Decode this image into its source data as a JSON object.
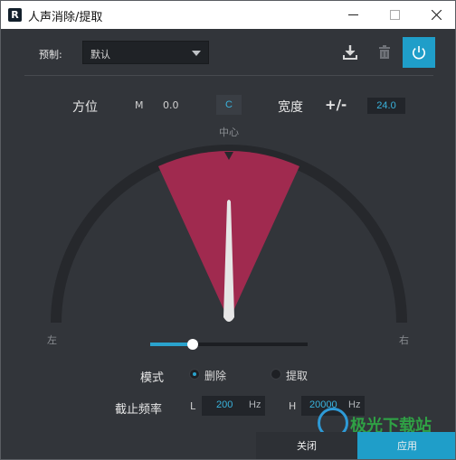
{
  "window": {
    "title": "人声消除/提取",
    "app_icon_letter": "R"
  },
  "toolbar": {
    "preset_label": "预制:",
    "preset_value": "默认"
  },
  "position": {
    "label": "方位",
    "m_label": "M",
    "value": "0.0",
    "center_button": "C"
  },
  "width": {
    "label": "宽度",
    "plus_minus": "+/-",
    "value": "24.0"
  },
  "dial": {
    "center_label": "中心",
    "left_label": "左",
    "right_label": "右"
  },
  "slider": {
    "fraction": 0.27
  },
  "mode": {
    "label": "模式",
    "options": [
      "删除",
      "提取"
    ],
    "selected": "删除"
  },
  "cutoff": {
    "label": "截止频率",
    "low_prefix": "L",
    "low_value": "200",
    "low_unit": "Hz",
    "high_prefix": "H",
    "high_value": "20000",
    "high_unit": "Hz"
  },
  "footer": {
    "close_label": "关闭",
    "apply_label": "应用"
  },
  "watermark": {
    "text": "极光下载站"
  },
  "colors": {
    "accent": "#1f9ec9",
    "sector": "#a02a4f",
    "background": "#32353a"
  }
}
